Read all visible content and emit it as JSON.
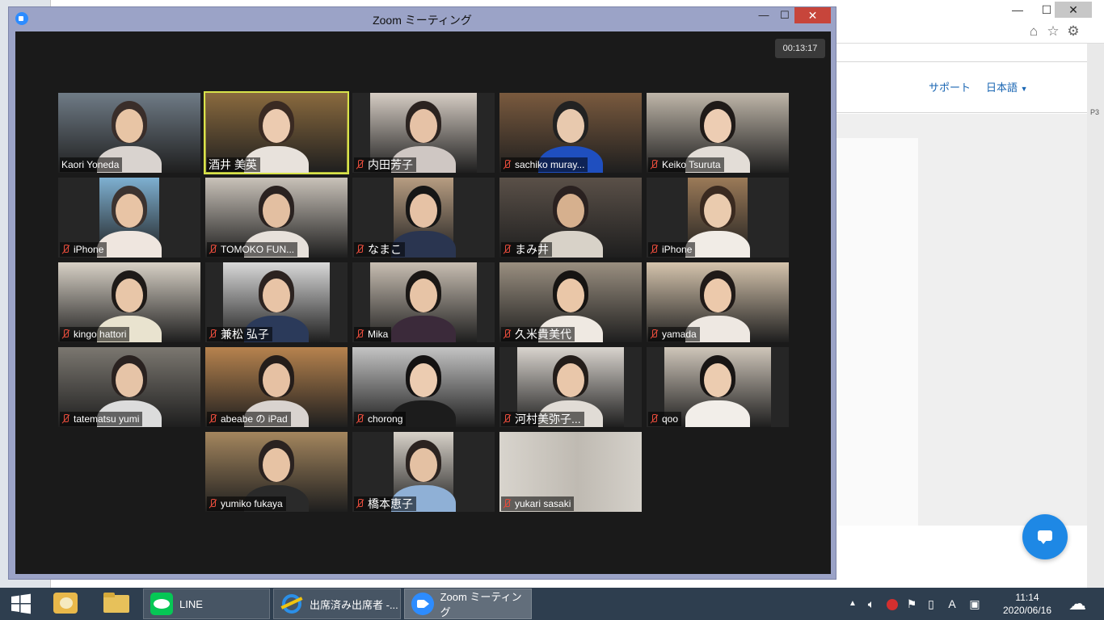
{
  "browser": {
    "nav": {
      "support": "サポート",
      "language": "日本語"
    },
    "edge_fragment": "P3"
  },
  "zoom": {
    "title": "Zoom ミーティング",
    "timer": "00:13:17",
    "participants": [
      "Kaori Yoneda",
      "酒井 美英",
      "内田芳子",
      "sachiko muray...",
      "Keiko  Tsuruta",
      "iPhone",
      "TOMOKO FUN...",
      "なまこ",
      "まみ井",
      "iPhone",
      "kingo hattori",
      "兼松 弘子",
      "Mika",
      "久米貴美代",
      "yamada",
      "tatematsu yumi",
      "abeabe の iPad",
      "chorong",
      "河村美弥子...",
      "qoo",
      "yumiko fukaya",
      "橋本恵子",
      "yukari sasaki"
    ]
  },
  "taskbar": {
    "apps": [
      {
        "label": "LINE",
        "icon": "line-icon"
      },
      {
        "label": "出席済み出席者 -...",
        "icon": "ie-icon"
      },
      {
        "label": "Zoom ミーティング",
        "icon": "zoom-icon"
      }
    ],
    "time": "11:14",
    "date": "2020/06/16",
    "ime": "A"
  }
}
